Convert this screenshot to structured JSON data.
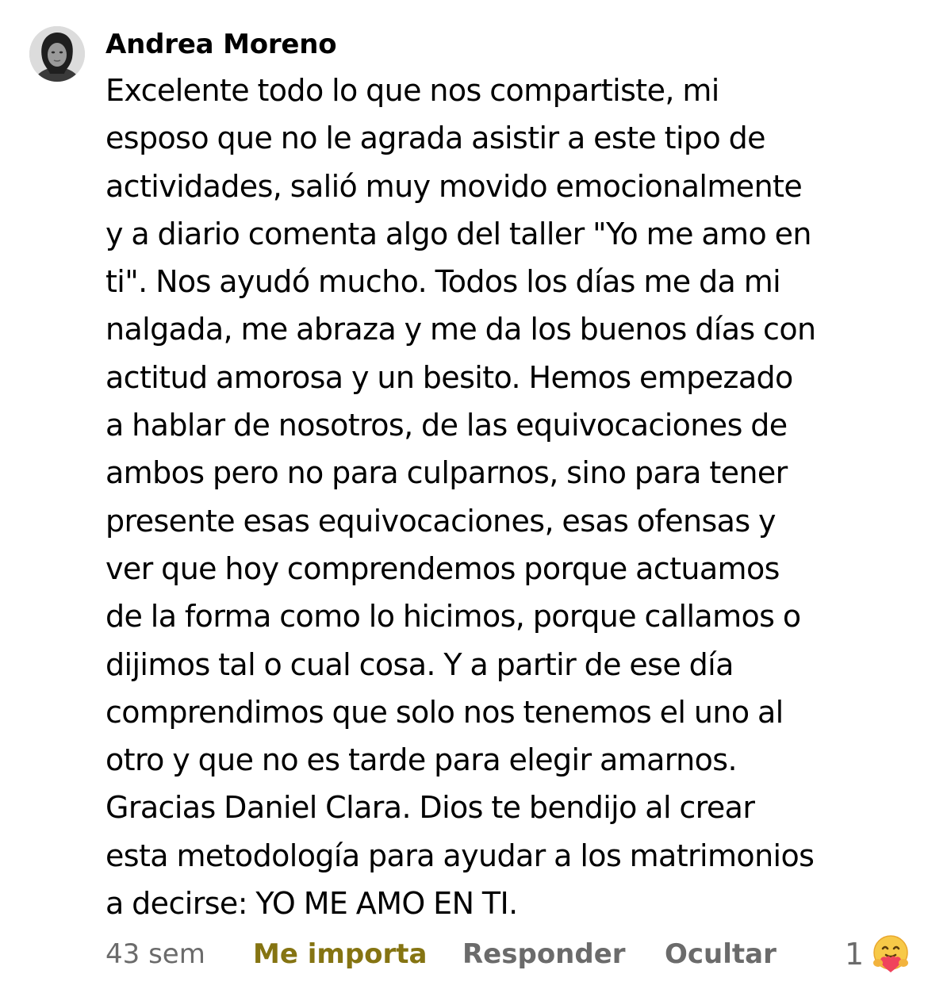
{
  "comment": {
    "author": "Andrea Moreno",
    "avatar_icon": "user-avatar-photo",
    "lines": [
      "Excelente todo lo que nos compartiste, mi",
      "esposo que no le agrada asistir a este tipo de",
      "actividades, salió muy movido emocionalmente",
      "y a diario comenta algo del taller \"Yo me amo en",
      "ti\". Nos ayudó mucho. Todos los días me da mi",
      "nalgada, me abraza y me da los buenos días con",
      "actitud amorosa y un besito. Hemos empezado",
      "a hablar de nosotros, de las equivocaciones de",
      "ambos pero no para culparnos, sino para tener",
      "presente esas equivocaciones, esas ofensas y",
      "ver que hoy comprendemos porque actuamos",
      "de la forma como lo hicimos, porque callamos o",
      "dijimos tal o cual cosa. Y a partir de ese día",
      "comprendimos que solo nos tenemos el uno al",
      "otro y que no es tarde para elegir amarnos.",
      "Gracias Daniel Clara. Dios te bendijo al crear",
      "esta metodología para ayudar a los matrimonios",
      "a decirse: YO ME AMO EN TI."
    ]
  },
  "actions": {
    "timestamp": "43 sem",
    "like_label": "Me importa",
    "like_color": "#857412",
    "reply_label": "Responder",
    "hide_label": "Ocultar",
    "reaction_count": "1",
    "reaction_icon": "care-reaction-icon"
  }
}
